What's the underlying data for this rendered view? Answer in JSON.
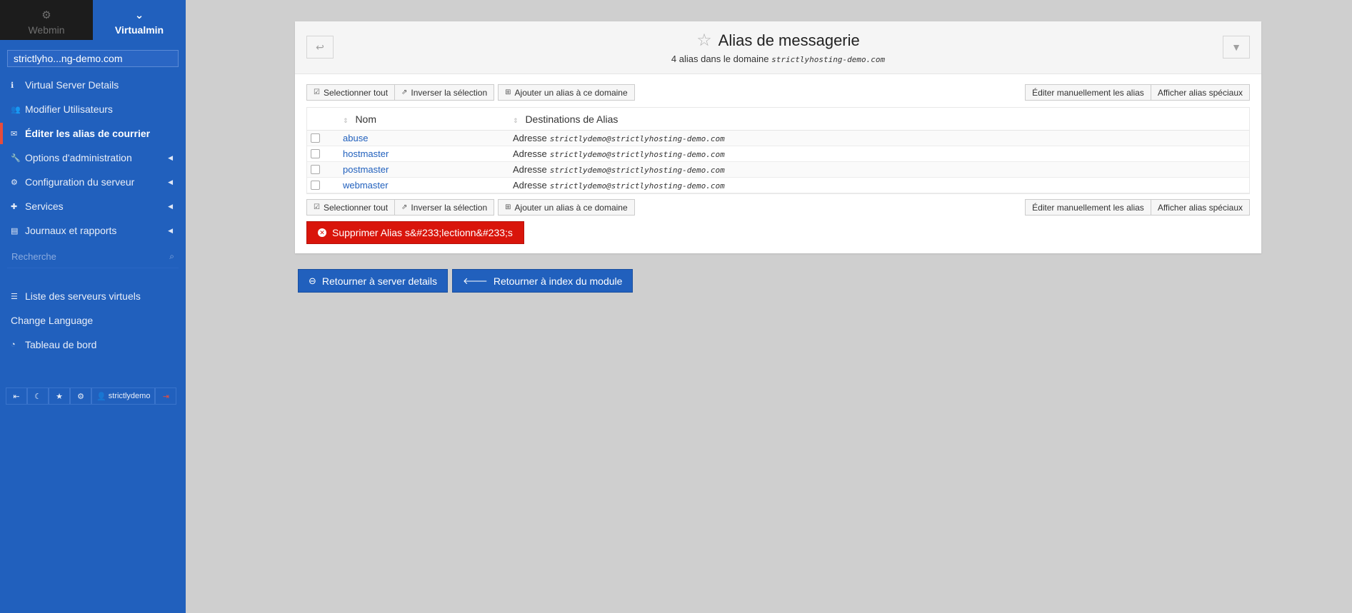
{
  "switcher": {
    "webmin_label": "Webmin",
    "virtualmin_label": "Virtualmin"
  },
  "sidebar": {
    "domain": "strictlyho...ng-demo.com",
    "items": [
      {
        "label": "Virtual Server Details",
        "icon": "info-icon"
      },
      {
        "label": "Modifier Utilisateurs",
        "icon": "users-icon"
      },
      {
        "label": "Éditer les alias de courrier",
        "icon": "envelope-icon",
        "active": true
      },
      {
        "label": "Options d'administration",
        "icon": "wrench-icon"
      },
      {
        "label": "Configuration du serveur",
        "icon": "cogs-icon"
      },
      {
        "label": "Services",
        "icon": "puzzle-icon"
      },
      {
        "label": "Journaux et rapports",
        "icon": "file-icon"
      }
    ],
    "search_placeholder": "Recherche",
    "links": [
      {
        "label": "Liste des serveurs virtuels",
        "icon": "list-icon"
      },
      {
        "label": "Change Language",
        "icon": ""
      },
      {
        "label": "Tableau de bord",
        "icon": "dashboard-icon"
      }
    ],
    "user": "strictlydemo"
  },
  "page": {
    "title": "Alias de messagerie",
    "subtitle": "4 alias dans le domaine",
    "subtitle_domain": "strictlyhosting-demo.com"
  },
  "toolbar": {
    "select_all": "Selectionner tout",
    "invert": "Inverser la sélection",
    "add_alias": "Ajouter un alias à ce domaine",
    "edit_manual": "Éditer manuellement les alias",
    "show_special": "Afficher alias spéciaux"
  },
  "table": {
    "col_name": "Nom",
    "col_dest": "Destinations de Alias",
    "rows": [
      {
        "name": "abuse",
        "dest_label": "Adresse",
        "dest": "strictlydemo@strictlyhosting-demo.com"
      },
      {
        "name": "hostmaster",
        "dest_label": "Adresse",
        "dest": "strictlydemo@strictlyhosting-demo.com"
      },
      {
        "name": "postmaster",
        "dest_label": "Adresse",
        "dest": "strictlydemo@strictlyhosting-demo.com"
      },
      {
        "name": "webmaster",
        "dest_label": "Adresse",
        "dest": "strictlydemo@strictlyhosting-demo.com"
      }
    ]
  },
  "delete_label": "Supprimer Alias s&#233;lectionn&#233;s",
  "nav": {
    "back_server": "Retourner à server details",
    "back_index": "Retourner à index du module"
  },
  "colors": {
    "sidebar": "#2160bd",
    "danger": "#d9150b",
    "link": "#2160bd"
  }
}
